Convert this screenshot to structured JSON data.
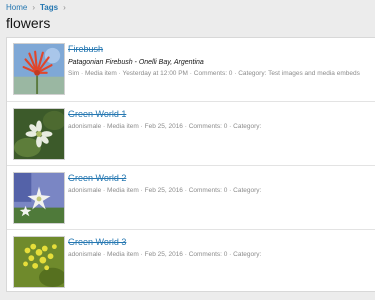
{
  "breadcrumb": {
    "items": [
      "Home",
      "Tags"
    ],
    "separator": "›"
  },
  "page": {
    "title": "flowers"
  },
  "results": [
    {
      "title": "Firebush",
      "snippet": "Patagonian Firebush - Onelli Bay, Argentina",
      "author": "Sim",
      "type": "Media item",
      "date": "Yesterday at 12:00 PM",
      "comments": "Comments: 0",
      "category": "Category: Test images and media embeds",
      "thumb_icon": "red-flower-photo"
    },
    {
      "title": "Green World 1",
      "snippet": "",
      "author": "adonismale",
      "type": "Media item",
      "date": "Feb 25, 2016",
      "comments": "Comments: 0",
      "category": "Category:",
      "thumb_icon": "white-flower-photo"
    },
    {
      "title": "Green World 2",
      "snippet": "",
      "author": "adonismale",
      "type": "Media item",
      "date": "Feb 25, 2016",
      "comments": "Comments: 0",
      "category": "Category:",
      "thumb_icon": "white-star-flower-photo"
    },
    {
      "title": "Green World 3",
      "snippet": "",
      "author": "adonismale",
      "type": "Media item",
      "date": "Feb 25, 2016",
      "comments": "Comments: 0",
      "category": "Category:",
      "thumb_icon": "yellow-flower-photo"
    }
  ],
  "meta_separator": " · ",
  "colors": {
    "link": "#2577b1",
    "muted": "#8c8c8c",
    "background": "#ececec"
  }
}
